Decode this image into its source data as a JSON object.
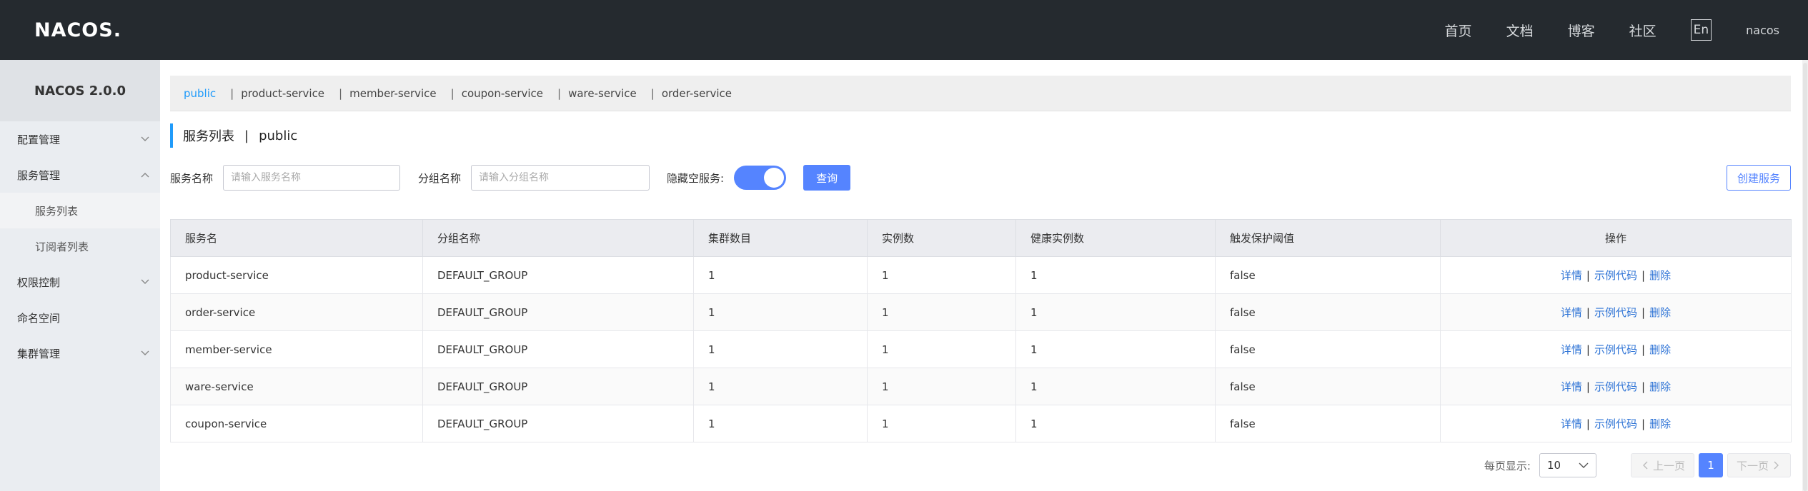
{
  "topbar": {
    "logo_text": "NACOS.",
    "nav": [
      "首页",
      "文档",
      "博客",
      "社区"
    ],
    "lang_button": "En",
    "user": "nacos"
  },
  "sidebar": {
    "version": "NACOS 2.0.0",
    "items": [
      {
        "label": "配置管理",
        "expanded": false
      },
      {
        "label": "服务管理",
        "expanded": true
      },
      {
        "label": "服务列表",
        "sub": true,
        "active": true
      },
      {
        "label": "订阅者列表",
        "sub": true
      },
      {
        "label": "权限控制",
        "expanded": false
      },
      {
        "label": "命名空间"
      },
      {
        "label": "集群管理",
        "expanded": false
      }
    ]
  },
  "namespaces": {
    "items": [
      "public",
      "product-service",
      "member-service",
      "coupon-service",
      "ware-service",
      "order-service"
    ],
    "separator": "|",
    "active": "public"
  },
  "page_title": {
    "title": "服务列表",
    "separator": "|",
    "namespace": "public"
  },
  "filter": {
    "service_name_label": "服务名称",
    "service_name_placeholder": "请输入服务名称",
    "group_name_label": "分组名称",
    "group_name_placeholder": "请输入分组名称",
    "hide_empty_label": "隐藏空服务:",
    "hide_empty_on": true,
    "query_button": "查询",
    "create_button": "创建服务"
  },
  "table": {
    "headers": [
      "服务名",
      "分组名称",
      "集群数目",
      "实例数",
      "健康实例数",
      "触发保护阈值",
      "操作"
    ],
    "rows": [
      [
        "product-service",
        "DEFAULT_GROUP",
        "1",
        "1",
        "1",
        "false"
      ],
      [
        "order-service",
        "DEFAULT_GROUP",
        "1",
        "1",
        "1",
        "false"
      ],
      [
        "member-service",
        "DEFAULT_GROUP",
        "1",
        "1",
        "1",
        "false"
      ],
      [
        "ware-service",
        "DEFAULT_GROUP",
        "1",
        "1",
        "1",
        "false"
      ],
      [
        "coupon-service",
        "DEFAULT_GROUP",
        "1",
        "1",
        "1",
        "false"
      ]
    ],
    "ops": {
      "detail": "详情",
      "sample": "示例代码",
      "delete": "删除",
      "separator": "|"
    }
  },
  "pagination": {
    "page_size_label": "每页显示:",
    "page_size": "10",
    "prev": "上一页",
    "next": "下一页",
    "current_page": "1"
  },
  "colors": {
    "topbar": "#252a2f",
    "accent": "#209bfa",
    "primary": "#5584ff",
    "link": "#2f74d6"
  }
}
